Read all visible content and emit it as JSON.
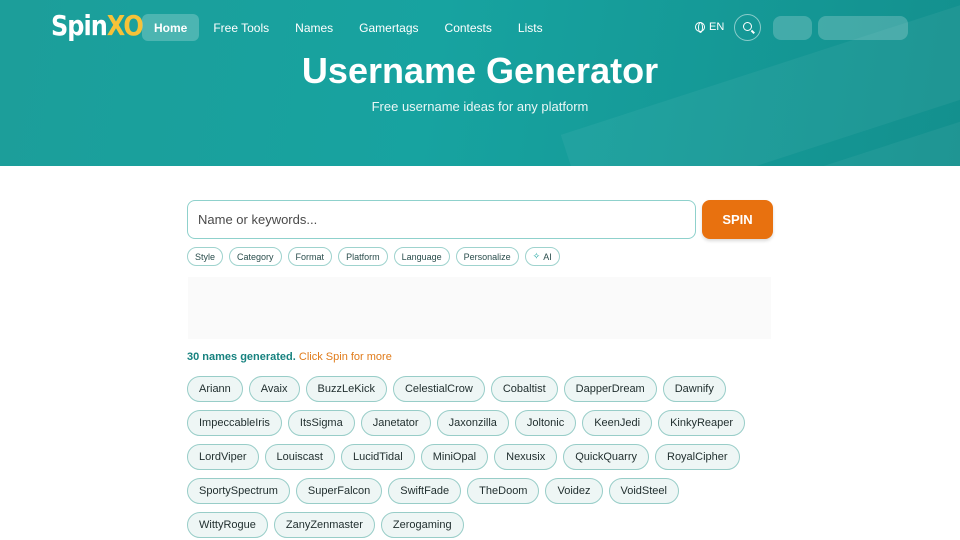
{
  "brand": {
    "logo_main": "Spin",
    "logo_accent": "XO"
  },
  "nav": {
    "items": [
      {
        "label": "Home",
        "active": true
      },
      {
        "label": "Free Tools",
        "active": false
      },
      {
        "label": "Names",
        "active": false
      },
      {
        "label": "Gamertags",
        "active": false
      },
      {
        "label": "Contests",
        "active": false
      },
      {
        "label": "Lists",
        "active": false
      }
    ],
    "language": "EN"
  },
  "hero": {
    "title": "Username Generator",
    "subtitle": "Free username ideas for any platform"
  },
  "search": {
    "placeholder": "Name or keywords...",
    "button_label": "SPIN"
  },
  "filters": [
    "Style",
    "Category",
    "Format",
    "Platform",
    "Language",
    "Personalize",
    "AI"
  ],
  "status": {
    "count_text": "30 names generated.",
    "more_text": "Click Spin for more"
  },
  "names": [
    "Ariann",
    "Avaix",
    "BuzzLeKick",
    "CelestialCrow",
    "Cobaltist",
    "DapperDream",
    "Dawnify",
    "ImpeccableIris",
    "ItsSigma",
    "Janetator",
    "Jaxonzilla",
    "Joltonic",
    "KeenJedi",
    "KinkyReaper",
    "LordViper",
    "Louiscast",
    "LucidTidal",
    "MiniOpal",
    "Nexusix",
    "QuickQuarry",
    "RoyalCipher",
    "SportySpectrum",
    "SuperFalcon",
    "SwiftFade",
    "TheDoom",
    "Voidez",
    "VoidSteel",
    "WittyRogue",
    "ZanyZenmaster",
    "Zerogaming"
  ],
  "colors": {
    "hero": "#17a3a0",
    "accent": "#e8710f",
    "logo_accent": "#f6c238",
    "chip_border": "#98cdc8"
  }
}
